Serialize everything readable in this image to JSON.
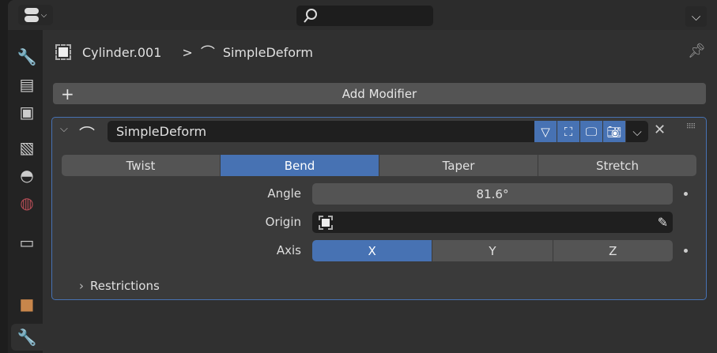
{
  "header": {
    "editor_type_icon": "properties-editor-icon",
    "search_placeholder": ""
  },
  "sidebar": {
    "tabs": [
      {
        "name": "tool",
        "icon": "wrench-screwdriver-icon",
        "glyph": "🔧"
      },
      {
        "name": "render",
        "icon": "render-icon",
        "glyph": "▤"
      },
      {
        "name": "output",
        "icon": "output-icon",
        "glyph": "▣"
      },
      {
        "name": "view-layer",
        "icon": "view-layer-icon",
        "glyph": "▧"
      },
      {
        "name": "scene",
        "icon": "scene-icon",
        "glyph": "◓"
      },
      {
        "name": "world",
        "icon": "world-icon",
        "glyph": "◍"
      },
      {
        "name": "collection",
        "icon": "collection-icon",
        "glyph": "▭"
      },
      {
        "name": "object",
        "icon": "object-icon",
        "glyph": "■"
      },
      {
        "name": "modifiers",
        "icon": "wrench-icon",
        "glyph": "🔧",
        "active": true
      }
    ]
  },
  "breadcrumb": {
    "object": "Cylinder.001",
    "separator": ">",
    "modifier": "SimpleDeform"
  },
  "add_modifier": {
    "plus": "+",
    "label": "Add Modifier"
  },
  "modifier": {
    "name": "SimpleDeform",
    "toggles": [
      "edit-mode-icon",
      "cage-icon",
      "viewport-icon",
      "render-icon"
    ],
    "modes": [
      "Twist",
      "Bend",
      "Taper",
      "Stretch"
    ],
    "selected_mode": "Bend",
    "angle_label": "Angle",
    "angle_value": "81.6°",
    "origin_label": "Origin",
    "origin_value": "",
    "axis_label": "Axis",
    "axes": [
      "X",
      "Y",
      "Z"
    ],
    "selected_axis": "X",
    "restrictions_label": "Restrictions"
  },
  "colors": {
    "accent": "#4772b3",
    "active_tab": "#4d8ff0",
    "object_icon": "#c8864b",
    "world_icon": "#b24c55"
  }
}
